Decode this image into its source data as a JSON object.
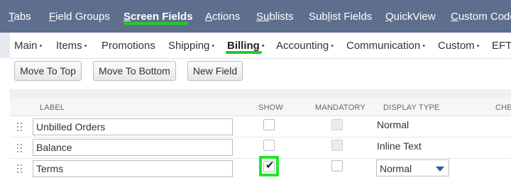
{
  "top_nav": {
    "tabs": [
      {
        "label": "Tabs",
        "ul": "T",
        "rest": "abs"
      },
      {
        "label": "Field Groups",
        "ul": "F",
        "rest": "ield Groups"
      },
      {
        "label": "Screen Fields",
        "ul": "S",
        "rest": "creen Fields"
      },
      {
        "label": "Actions",
        "ul": "A",
        "rest": "ctions"
      },
      {
        "label": "Sublists",
        "ul": "Su",
        "rest": "blists"
      },
      {
        "label": "Sublist Fields",
        "pre": "Sub",
        "ul": "l",
        "rest": "ist Fields"
      },
      {
        "label": "QuickView",
        "ul": "Q",
        "rest": "uickView"
      },
      {
        "label": "Custom Code",
        "ul": "C",
        "rest": "ustom Code"
      }
    ],
    "active": "Screen Fields"
  },
  "sub_tabs": [
    {
      "label": "Main",
      "dot": "•"
    },
    {
      "label": "Items",
      "dot": "•"
    },
    {
      "label": "Promotions",
      "dot": ""
    },
    {
      "label": "Shipping",
      "dot": "•"
    },
    {
      "label": "Billing",
      "dot": "•"
    },
    {
      "label": "Accounting",
      "dot": "•"
    },
    {
      "label": "Communication",
      "dot": "•"
    },
    {
      "label": "Custom",
      "dot": "•"
    },
    {
      "label": "EFT",
      "dot": "•"
    }
  ],
  "active_sub_tab": "Billing",
  "buttons": {
    "move_to_top": "Move To Top",
    "move_to_bottom": "Move To Bottom",
    "new_field": "New Field"
  },
  "table": {
    "headers": {
      "label": "LABEL",
      "show": "SHOW",
      "mandatory": "MANDATORY",
      "display_type": "DISPLAY TYPE",
      "checkout": "CHE"
    },
    "rows": [
      {
        "label": "Unbilled Orders",
        "show": false,
        "mandatory_disabled": true,
        "display_type": "Normal",
        "display_editable": false
      },
      {
        "label": "Balance",
        "show": false,
        "mandatory_disabled": true,
        "display_type": "Inline Text",
        "display_editable": false
      },
      {
        "label": "Terms",
        "show": true,
        "mandatory_disabled": false,
        "display_type": "Normal",
        "display_editable": true
      }
    ]
  },
  "colors": {
    "nav_bg": "#5e6f8e",
    "highlight": "#22e62b"
  }
}
